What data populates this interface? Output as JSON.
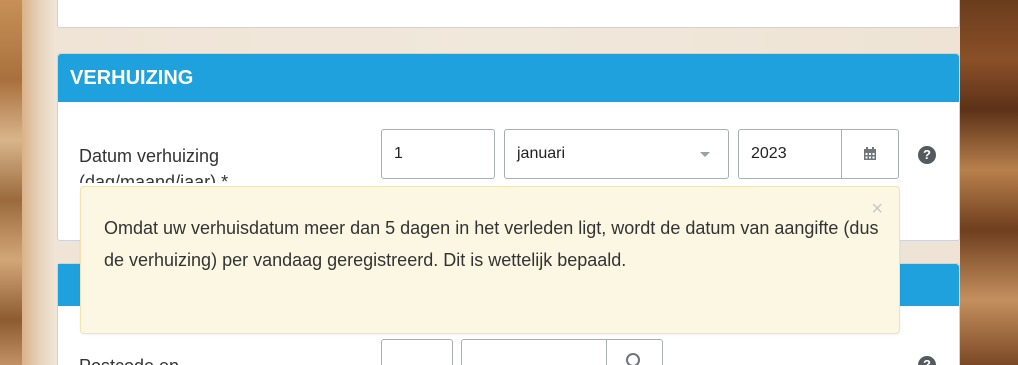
{
  "section": {
    "title": "VERHUIZING"
  },
  "move_date": {
    "label": "Datum verhuizing",
    "label_cut": "(dag/maand/jaar) *",
    "day": "1",
    "month": "januari",
    "year": "2023"
  },
  "tooltip": {
    "text": "Omdat uw verhuisdatum meer dan 5 dagen in het verleden ligt, wordt de datum van aangifte (dus de verhuizing) per vandaag geregistreerd. Dit is wettelijk bepaald.",
    "close": "×"
  },
  "next_field": {
    "label": "Postcode en"
  },
  "help_icon": "?",
  "colors": {
    "header": "#1ea1dc",
    "tooltip_bg": "#fcf7e3"
  },
  "icons": [
    "calendar-icon",
    "help-icon",
    "close-icon",
    "search-icon",
    "chevron-down-icon"
  ]
}
